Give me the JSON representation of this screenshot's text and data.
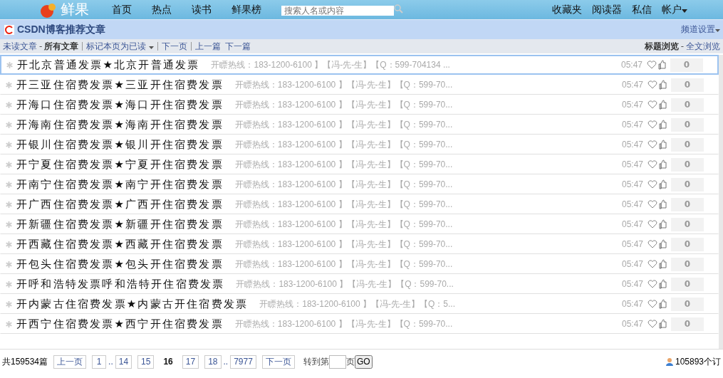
{
  "header": {
    "logo": "鲜果",
    "nav": [
      "首页",
      "热点",
      "读书",
      "鲜果榜"
    ],
    "search": {
      "placeholder": "搜索人名或内容"
    },
    "links": [
      "收藏夹",
      "阅读器",
      "私信"
    ],
    "account": "帐户"
  },
  "channel": {
    "title": "CSDN博客推荐文章",
    "settings": "频道设置"
  },
  "toolbar": {
    "unread": "未读文章",
    "dash": "-",
    "all": "所有文章",
    "mark_read": "标记本页为已读",
    "next_page": "下一页",
    "prev_article": "上一篇",
    "next_article": "下一篇",
    "title_view": "标题浏览",
    "view_dash": "-",
    "full_view": "全文浏览"
  },
  "articles": [
    {
      "title": "开北京普通发票★北京开普通发票",
      "snippet": "开瞟热线：183-1200-6100 】【冯-先-生】【Q：599-704134 ...",
      "time": "05:47",
      "votes": "0",
      "selected": true
    },
    {
      "title": "开三亚住宿费发票★三亚开住宿费发票",
      "snippet": "开瞟热线：183-1200-6100 】【冯-先-生】【Q：599-70...",
      "time": "05:47",
      "votes": "0",
      "selected": false
    },
    {
      "title": "开海口住宿费发票★海口开住宿费发票",
      "snippet": "开瞟热线：183-1200-6100 】【冯-先-生】【Q：599-70...",
      "time": "05:47",
      "votes": "0",
      "selected": false
    },
    {
      "title": "开海南住宿费发票★海南开住宿费发票",
      "snippet": "开瞟热线：183-1200-6100 】【冯-先-生】【Q：599-70...",
      "time": "05:47",
      "votes": "0",
      "selected": false
    },
    {
      "title": "开银川住宿费发票★银川开住宿费发票",
      "snippet": "开瞟热线：183-1200-6100 】【冯-先-生】【Q：599-70...",
      "time": "05:47",
      "votes": "0",
      "selected": false
    },
    {
      "title": "开宁夏住宿费发票★宁夏开住宿费发票",
      "snippet": "开瞟热线：183-1200-6100 】【冯-先-生】【Q：599-70...",
      "time": "05:47",
      "votes": "0",
      "selected": false
    },
    {
      "title": "开南宁住宿费发票★南宁开住宿费发票",
      "snippet": "开瞟热线：183-1200-6100 】【冯-先-生】【Q：599-70...",
      "time": "05:47",
      "votes": "0",
      "selected": false
    },
    {
      "title": "开广西住宿费发票★广西开住宿费发票",
      "snippet": "开瞟热线：183-1200-6100 】【冯-先-生】【Q：599-70...",
      "time": "05:47",
      "votes": "0",
      "selected": false
    },
    {
      "title": "开新疆住宿费发票★新疆开住宿费发票",
      "snippet": "开瞟热线：183-1200-6100 】【冯-先-生】【Q：599-70...",
      "time": "05:47",
      "votes": "0",
      "selected": false
    },
    {
      "title": "开西藏住宿费发票★西藏开住宿费发票",
      "snippet": "开瞟热线：183-1200-6100 】【冯-先-生】【Q：599-70...",
      "time": "05:47",
      "votes": "0",
      "selected": false
    },
    {
      "title": "开包头住宿费发票★包头开住宿费发票",
      "snippet": "开瞟热线：183-1200-6100 】【冯-先-生】【Q：599-70...",
      "time": "05:47",
      "votes": "0",
      "selected": false
    },
    {
      "title": "开呼和浩特发票呼和浩特开住宿费发票",
      "snippet": "开瞟热线：183-1200-6100 】【冯-先-生】【Q：599-70...",
      "time": "05:47",
      "votes": "0",
      "selected": false
    },
    {
      "title": "开内蒙古住宿费发票★内蒙古开住宿费发票",
      "snippet": "开瞟热线：183-1200-6100 】【冯-先-生】【Q：5...",
      "time": "05:47",
      "votes": "0",
      "selected": false
    },
    {
      "title": "开西宁住宿费发票★西宁开住宿费发票",
      "snippet": "开瞟热线：183-1200-6100 】【冯-先-生】【Q：599-70...",
      "time": "05:47",
      "votes": "0",
      "selected": false
    }
  ],
  "pager": {
    "total": "共159534篇",
    "prev": "上一页",
    "pages": [
      {
        "label": "1",
        "selected": false
      },
      {
        "label": "..",
        "kind": "gap"
      },
      {
        "label": "14",
        "selected": false
      },
      {
        "label": "15",
        "selected": false
      },
      {
        "label": "16",
        "selected": true
      },
      {
        "label": "17",
        "selected": false
      },
      {
        "label": "18",
        "selected": false
      },
      {
        "label": "..",
        "kind": "gap"
      },
      {
        "label": "7977",
        "selected": false
      }
    ],
    "next": "下一页",
    "goto_before": "转到第",
    "goto_after": "页",
    "go": "GO",
    "subscribers": "105893个订"
  }
}
